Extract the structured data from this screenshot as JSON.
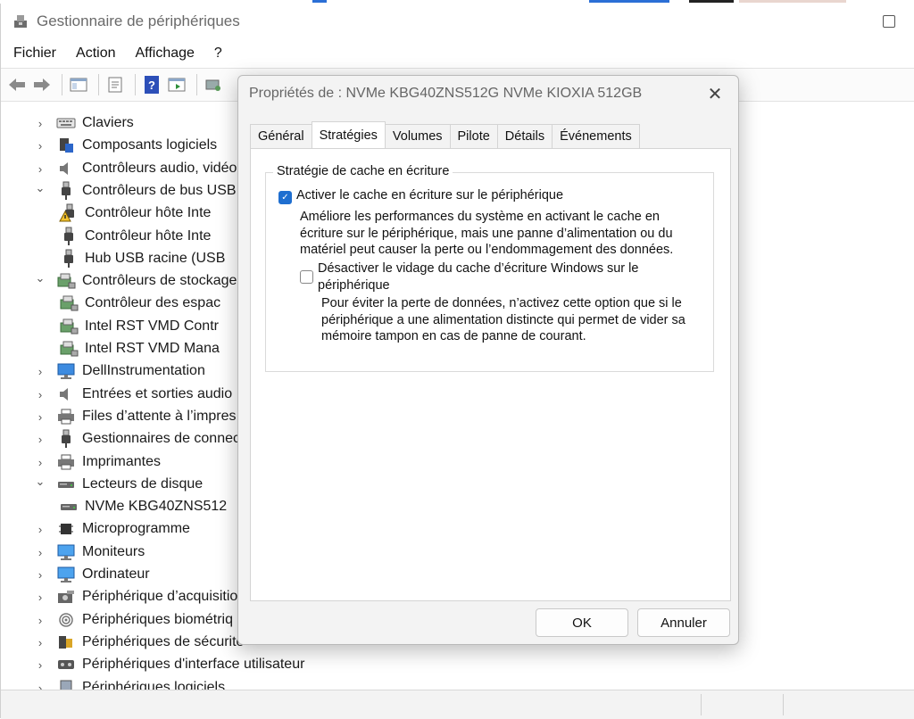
{
  "window": {
    "title": "Gestionnaire de périphériques"
  },
  "menu": [
    "Fichier",
    "Action",
    "Affichage",
    "?"
  ],
  "tree": [
    {
      "label": "Claviers",
      "icon": "keyboard-icon",
      "level": 0,
      "state": "collapsed"
    },
    {
      "label": "Composants logiciels",
      "icon": "software-component-icon",
      "level": 0,
      "state": "collapsed"
    },
    {
      "label": "Contrôleurs audio, vidéo",
      "icon": "speaker-icon",
      "level": 0,
      "state": "collapsed"
    },
    {
      "label": "Contrôleurs de bus USB",
      "icon": "usb-icon",
      "level": 0,
      "state": "expanded"
    },
    {
      "label": "Contrôleur hôte Inte",
      "icon": "usb-warning-icon",
      "level": 1
    },
    {
      "label": "Contrôleur hôte Inte",
      "icon": "usb-icon",
      "level": 1
    },
    {
      "label": "Hub USB racine (USB",
      "icon": "usb-icon",
      "level": 1
    },
    {
      "label": "Contrôleurs de stockage",
      "icon": "storage-controller-icon",
      "level": 0,
      "state": "expanded"
    },
    {
      "label": "Contrôleur des espac",
      "icon": "storage-controller-icon",
      "level": 1
    },
    {
      "label": "Intel RST VMD Contr",
      "icon": "storage-controller-icon",
      "level": 1
    },
    {
      "label": "Intel RST VMD Mana",
      "icon": "storage-controller-icon",
      "level": 1
    },
    {
      "label": "DellInstrumentation",
      "icon": "monitor-network-icon",
      "level": 0,
      "state": "collapsed"
    },
    {
      "label": "Entrées et sorties audio",
      "icon": "speaker-icon",
      "level": 0,
      "state": "collapsed"
    },
    {
      "label": "Files d’attente à l’impres",
      "icon": "printer-icon",
      "level": 0,
      "state": "collapsed"
    },
    {
      "label": "Gestionnaires de connec",
      "icon": "usb-icon",
      "level": 0,
      "state": "collapsed"
    },
    {
      "label": "Imprimantes",
      "icon": "printer-icon",
      "level": 0,
      "state": "collapsed"
    },
    {
      "label": "Lecteurs de disque",
      "icon": "disk-drive-icon",
      "level": 0,
      "state": "expanded"
    },
    {
      "label": "NVMe KBG40ZNS512",
      "icon": "disk-drive-icon",
      "level": 1
    },
    {
      "label": "Microprogramme",
      "icon": "chip-icon",
      "level": 0,
      "state": "collapsed"
    },
    {
      "label": "Moniteurs",
      "icon": "monitor-icon",
      "level": 0,
      "state": "collapsed"
    },
    {
      "label": "Ordinateur",
      "icon": "monitor-icon",
      "level": 0,
      "state": "collapsed"
    },
    {
      "label": "Périphérique d’acquisitio",
      "icon": "camera-icon",
      "level": 0,
      "state": "collapsed"
    },
    {
      "label": "Périphériques biométriq",
      "icon": "fingerprint-icon",
      "level": 0,
      "state": "collapsed"
    },
    {
      "label": "Périphériques de sécurité",
      "icon": "security-device-icon",
      "level": 0,
      "state": "collapsed"
    },
    {
      "label": "Périphériques d'interface utilisateur",
      "icon": "hid-icon",
      "level": 0,
      "state": "collapsed"
    },
    {
      "label": "Périphériques logiciels",
      "icon": "software-device-icon",
      "level": 0,
      "state": "collapsed"
    }
  ],
  "dialog": {
    "title": "Propriétés de : NVMe KBG40ZNS512G NVMe KIOXIA 512GB",
    "tabs": [
      "Général",
      "Stratégies",
      "Volumes",
      "Pilote",
      "Détails",
      "Événements"
    ],
    "active_tab": "Stratégies",
    "group_title": "Stratégie de cache en écriture",
    "option1": {
      "label": "Activer le cache en écriture sur le périphérique",
      "checked": true,
      "desc": [
        "Améliore les performances du système en activant le cache en",
        "écriture sur le périphérique, mais une panne d’alimentation ou du",
        "matériel peut causer la perte ou l’endommagement des données."
      ]
    },
    "option2": {
      "label_lines": [
        "Désactiver le vidage du cache d’écriture Windows sur le",
        "périphérique"
      ],
      "checked": false,
      "desc": [
        "Pour éviter la perte de données, n’activez cette option que si le",
        "périphérique a une alimentation distincte qui permet de vider sa",
        "mémoire tampon en cas de panne de courant."
      ]
    },
    "ok": "OK",
    "cancel": "Annuler"
  }
}
